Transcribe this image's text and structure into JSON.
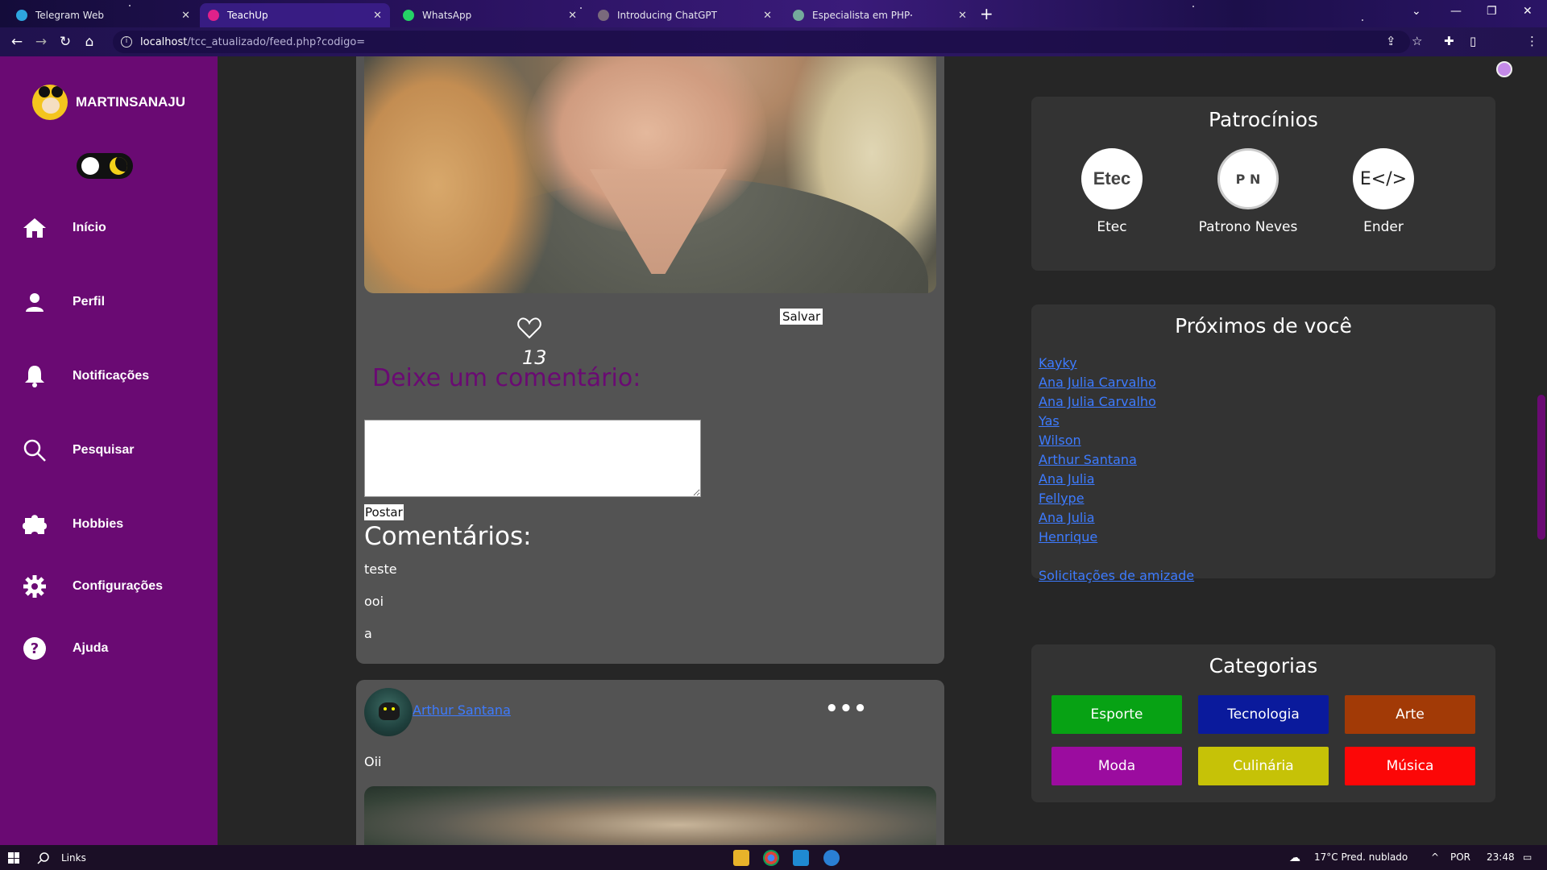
{
  "browser": {
    "tabs": [
      {
        "label": "Telegram Web",
        "fav_color": "#2ea6df",
        "active": false
      },
      {
        "label": "TeachUp",
        "fav_color": "#e0218a",
        "active": true
      },
      {
        "label": "WhatsApp",
        "fav_color": "#25d366",
        "active": false
      },
      {
        "label": "Introducing ChatGPT",
        "fav_color": "#7a6a7c",
        "active": false
      },
      {
        "label": "Especialista em PHP",
        "fav_color": "#74aa9c",
        "active": false
      }
    ],
    "url_host": "localhost",
    "url_path": "/tcc_atualizado/feed.php?codigo="
  },
  "sidebar": {
    "username": "MARTINSANAJU",
    "items": [
      {
        "label": "Início",
        "icon": "home-icon"
      },
      {
        "label": "Perfil",
        "icon": "user-icon"
      },
      {
        "label": "Notificações",
        "icon": "bell-icon"
      },
      {
        "label": "Pesquisar",
        "icon": "search-icon"
      },
      {
        "label": "Hobbies",
        "icon": "puzzle-icon"
      },
      {
        "label": "Configurações",
        "icon": "gear-icon"
      },
      {
        "label": "Ajuda",
        "icon": "help-icon"
      }
    ]
  },
  "post": {
    "likes": "13",
    "save_label": "Salvar",
    "comment_heading": "Deixe um comentário:",
    "post_button": "Postar",
    "comments_title": "Comentários:",
    "comments": [
      "teste",
      "ooi",
      "a"
    ]
  },
  "post2": {
    "author": "Arthur Santana",
    "text": "Oii",
    "menu_icon": "more-icon"
  },
  "sponsors": {
    "title": "Patrocínios",
    "items": [
      {
        "name": "Etec",
        "logo_text": "Etec"
      },
      {
        "name": "Patrono Neves",
        "logo_text": "P N"
      },
      {
        "name": "Ender",
        "logo_text": "E</>"
      }
    ]
  },
  "nearby": {
    "title": "Próximos de você",
    "people": [
      "Kayky",
      "Ana Julia Carvalho",
      "Ana Julia Carvalho",
      "Yas",
      "Wilson",
      "Arthur Santana",
      "Ana Julia",
      "Fellype",
      "Ana Julia",
      "Henrique"
    ],
    "friend_requests": "Solicitações de amizade"
  },
  "categories": {
    "title": "Categorias",
    "items": [
      {
        "label": "Esporte",
        "color": "#07a214"
      },
      {
        "label": "Tecnologia",
        "color": "#0a1a9c"
      },
      {
        "label": "Arte",
        "color": "#a23a06"
      },
      {
        "label": "Moda",
        "color": "#9b0c9f"
      },
      {
        "label": "Culinária",
        "color": "#c6c207"
      },
      {
        "label": "Música",
        "color": "#fc0707"
      }
    ]
  },
  "taskbar": {
    "search_label": "Links",
    "weather": "17°C  Pred. nublado",
    "lang": "POR",
    "time": "23:48"
  }
}
